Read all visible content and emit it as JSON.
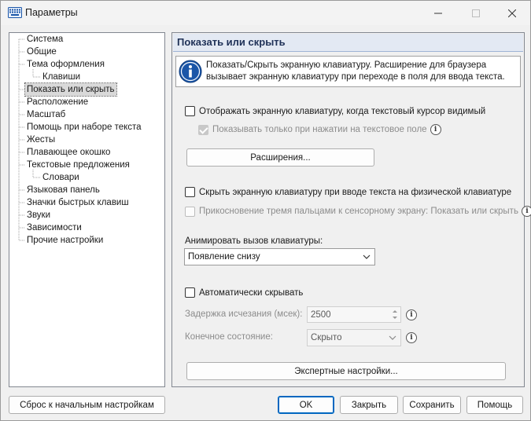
{
  "window": {
    "title": "Параметры"
  },
  "tree": {
    "items": [
      {
        "label": "Система",
        "level": 0
      },
      {
        "label": "Общие",
        "level": 0
      },
      {
        "label": "Тема оформления",
        "level": 0
      },
      {
        "label": "Клавиши",
        "level": 1
      },
      {
        "label": "Показать или скрыть",
        "level": 0,
        "selected": true
      },
      {
        "label": "Расположение",
        "level": 0
      },
      {
        "label": "Масштаб",
        "level": 0
      },
      {
        "label": "Помощь при наборе текста",
        "level": 0
      },
      {
        "label": "Жесты",
        "level": 0
      },
      {
        "label": "Плавающее окошко",
        "level": 0
      },
      {
        "label": "Текстовые предложения",
        "level": 0
      },
      {
        "label": "Словари",
        "level": 1
      },
      {
        "label": "Языковая панель",
        "level": 0
      },
      {
        "label": "Значки быстрых клавиш",
        "level": 0
      },
      {
        "label": "Звуки",
        "level": 0
      },
      {
        "label": "Зависимости",
        "level": 0
      },
      {
        "label": "Прочие настройки",
        "level": 0
      }
    ]
  },
  "panel": {
    "title": "Показать или скрыть",
    "info_line1": "Показать/Скрыть экранную клавиатуру. Расширение для браузера",
    "info_line2": "вызывает экранную клавиатуру при переходе в поля для ввода текста.",
    "show_when_cursor": {
      "label": "Отображать экранную клавиатуру, когда текстовый курсор видимый",
      "checked": false
    },
    "show_only_on_tap": {
      "label": "Показывать только при нажатии на текстовое поле",
      "checked": true,
      "disabled": true
    },
    "extensions_button": "Расширения...",
    "hide_on_physical": {
      "label": "Скрыть экранную клавиатуру при вводе текста на физической клавиатуре",
      "checked": false
    },
    "three_finger_touch": {
      "label": "Прикосновение тремя пальцами к сенсорному экрану: Показать или скрыть",
      "checked": false,
      "disabled": true
    },
    "animate_label": "Анимировать вызов клавиатуры:",
    "animate_value": "Появление снизу",
    "auto_hide": {
      "label": "Автоматически скрывать",
      "checked": false
    },
    "fade_delay_label": "Задержка исчезания (мсек):",
    "fade_delay_value": "2500",
    "final_state_label": "Конечное состояние:",
    "final_state_value": "Скрыто",
    "expert_button": "Экспертные настройки..."
  },
  "footer": {
    "reset": "Сброс к начальным настройкам",
    "ok": "OK",
    "close": "Закрыть",
    "save": "Сохранить",
    "help": "Помощь"
  },
  "colors": {
    "accent": "#0067c0",
    "header_bg": "#e3e9f3",
    "info_icon": "#1b56a8"
  }
}
